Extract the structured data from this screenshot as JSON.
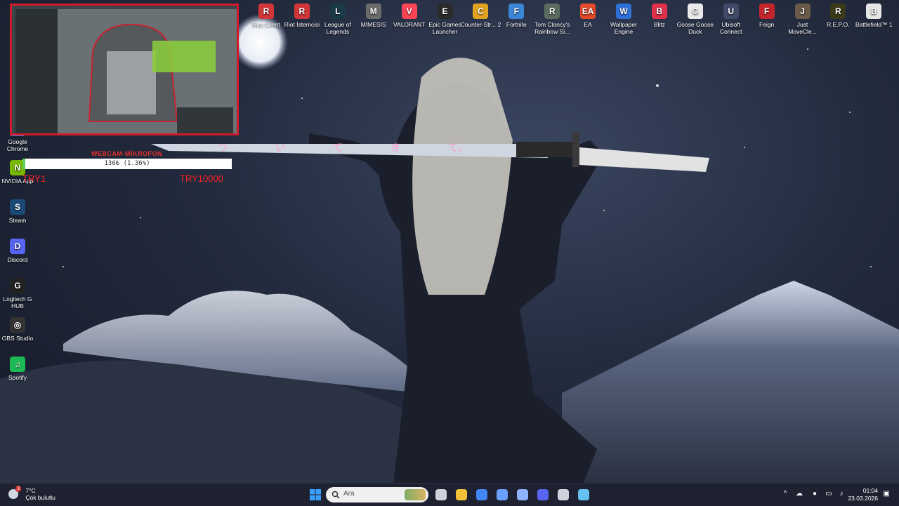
{
  "desktop_top_icons": [
    {
      "label": "Riot Client",
      "color": "#d13639",
      "glyph": "R"
    },
    {
      "label": "Riot İstemcisi",
      "color": "#d13639",
      "glyph": "R"
    },
    {
      "label": "League of Legends",
      "color": "#1b3a48",
      "glyph": "L"
    },
    {
      "label": "MIMESIS",
      "color": "#6b6b6b",
      "glyph": "M"
    },
    {
      "label": "VALORANT",
      "color": "#fd4556",
      "glyph": "V"
    },
    {
      "label": "Epic Games Launcher",
      "color": "#2a2a2a",
      "glyph": "E"
    },
    {
      "label": "Counter-Str... 2",
      "color": "#e0a321",
      "glyph": "C"
    },
    {
      "label": "Fortnite",
      "color": "#3b86d6",
      "glyph": "F"
    },
    {
      "label": "Tom Clancy's Rainbow Si...",
      "color": "#5b6b5d",
      "glyph": "R"
    },
    {
      "label": "EA",
      "color": "#e34a2b",
      "glyph": "EA"
    },
    {
      "label": "Wallpaper Engine",
      "color": "#2e6fd8",
      "glyph": "W"
    },
    {
      "label": "Blitz",
      "color": "#e0304b",
      "glyph": "B"
    },
    {
      "label": "Goose Goose Duck",
      "color": "#eaeaea",
      "glyph": "G"
    },
    {
      "label": "Ubisoft Connect",
      "color": "#3e4a66",
      "glyph": "U"
    },
    {
      "label": "Feign",
      "color": "#c2262c",
      "glyph": "F"
    },
    {
      "label": "Just MoveCle...",
      "color": "#6a5a4a",
      "glyph": "J"
    },
    {
      "label": "R.E.P.O.",
      "color": "#3a3a1a",
      "glyph": "R"
    },
    {
      "label": "Battlefield™ 1",
      "color": "#e6e6e6",
      "glyph": "B"
    }
  ],
  "desktop_left_icons": [
    {
      "label": "Google Chrome",
      "color": "#4285f4",
      "glyph": "●"
    },
    {
      "label": "NVIDIA App",
      "color": "#76b900",
      "glyph": "N"
    },
    {
      "label": "Steam",
      "color": "#1b4a78",
      "glyph": "S"
    },
    {
      "label": "Discord",
      "color": "#5865f2",
      "glyph": "D"
    },
    {
      "label": "Logitech G HUB",
      "color": "#222",
      "glyph": "G"
    },
    {
      "label": "OBS Studio",
      "color": "#333",
      "glyph": "◎"
    },
    {
      "label": "Spotify",
      "color": "#1db954",
      "glyph": "♫"
    }
  ],
  "webcam_overlay": {
    "webcam_label": "WEBCAM-MİKROFON",
    "donation_text": "136₺ (1.36%)",
    "donation_progress_percent": 1.36,
    "min_label": "TRY1",
    "max_label": "TRY10000"
  },
  "wallpaper": {
    "katana_text": [
      "つ",
      "い",
      "て",
      "き",
      "て。"
    ]
  },
  "taskbar": {
    "weather_temp": "7°C",
    "weather_desc": "Çok bulutlu",
    "weather_badge": "3",
    "search_placeholder": "Ara",
    "clock_time": "01:04",
    "clock_date": "23.03.2026",
    "pinned": [
      {
        "name": "task-view",
        "color": "#cfd3dc"
      },
      {
        "name": "file-explorer",
        "color": "#f3c13a"
      },
      {
        "name": "chrome",
        "color": "#4285f4"
      },
      {
        "name": "app-diamond",
        "color": "#6aa0ff"
      },
      {
        "name": "app-circles",
        "color": "#8fb3ff"
      },
      {
        "name": "discord",
        "color": "#5865f2"
      },
      {
        "name": "obs",
        "color": "#cfd3dc"
      },
      {
        "name": "steam",
        "color": "#66c0f4"
      }
    ]
  }
}
